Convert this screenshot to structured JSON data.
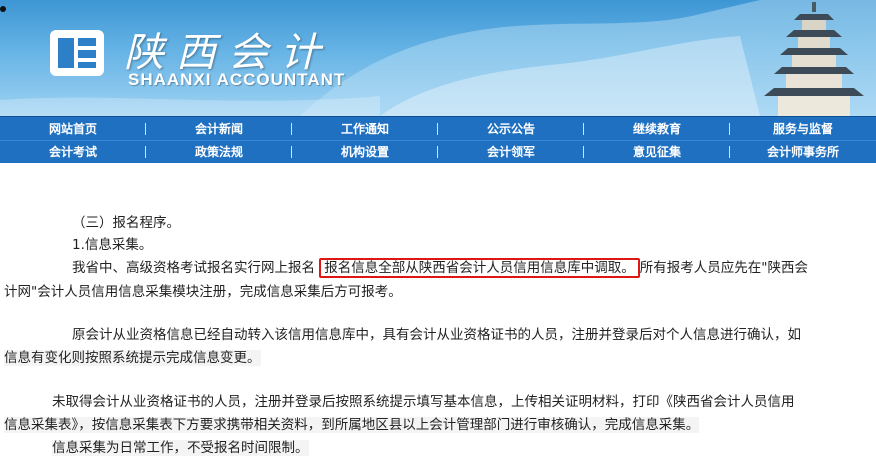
{
  "site": {
    "title": "陕西会计",
    "subtitle": "SHAANXI ACCOUNTANT"
  },
  "nav": {
    "row1": [
      "网站首页",
      "会计新闻",
      "工作通知",
      "公示公告",
      "继续教育",
      "服务与监督"
    ],
    "row2": [
      "会计考试",
      "政策法规",
      "机构设置",
      "会计领军",
      "意见征集",
      "会计师事务所"
    ]
  },
  "content": {
    "section_heading": "（三）报名程序。",
    "item_heading": "1.信息采集。",
    "p1_part1": "我省中、高级资格考试报名实行网上报名",
    "p1_highlight": "报名信息全部从陕西省会计人员信用信息库中调取。",
    "p1_part2": "所有报考人员应先在\"陕西会",
    "p1_line2": "计网\"会计人员信用信息采集模块注册，完成信息采集后方可报考。",
    "p2_line1": "原会计从业资格信息已经自动转入该信用信息库中，具有会计从业资格证书的人员，注册并登录后对个人信息进行确认，如",
    "p2_line2": "信息有变化则按照系统提示完成信息变更。",
    "p3_line1": "未取得会计从业资格证书的人员，注册并登录后按照系统提示填写基本信息，上传相关证明材料，打印《陕西省会计人员信用",
    "p3_line2": "信息采集表》，按信息采集表下方要求携带相关资料，到所属地区县以上会计管理部门进行审核确认，完成信息采集。",
    "p4_line1": "信息采集为日常工作，不受报名时间限制。"
  },
  "colors": {
    "nav_bg": "#1f70c1",
    "highlight_border": "#e01515",
    "banner_sky": "#67b4e6"
  },
  "icons": {
    "logo": "shaanxi-accountant-logo-icon",
    "pagoda": "pagoda-icon"
  }
}
